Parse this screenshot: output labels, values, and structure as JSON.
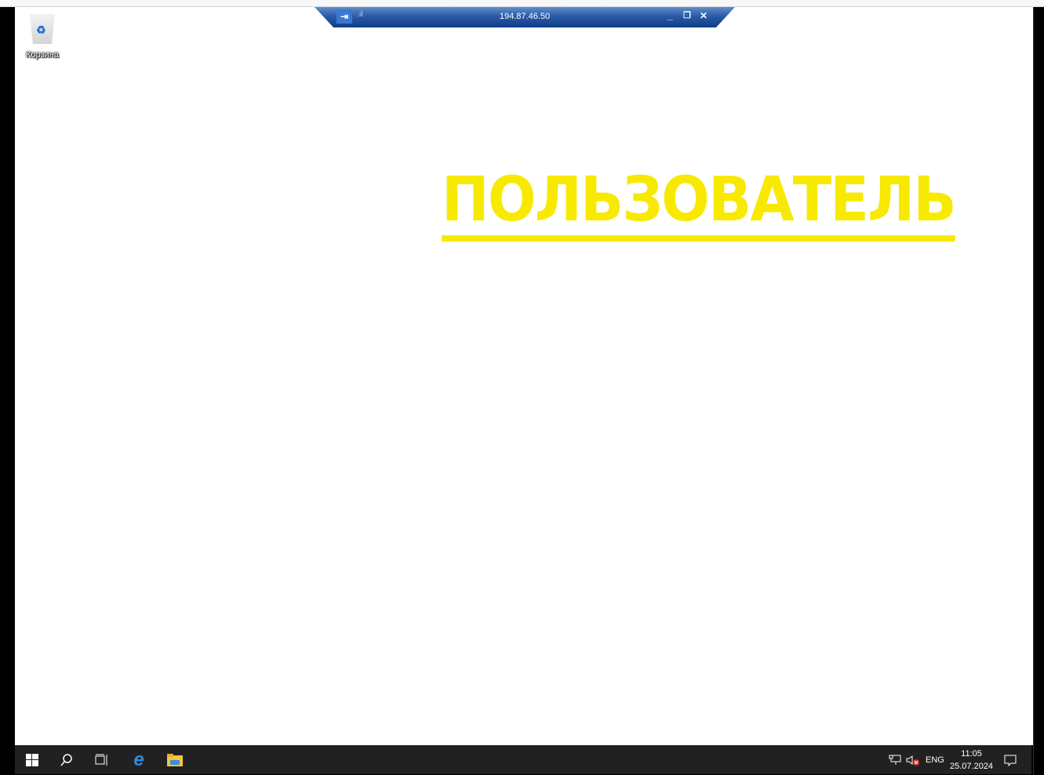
{
  "rdp_bar": {
    "host": "194.87.46.50",
    "pin_icon": "pin-icon",
    "signal_icon": "signal-icon",
    "minimize": "_",
    "restore": "❐",
    "close": "✕"
  },
  "desktop": {
    "icons": [
      {
        "label": "Корзина",
        "icon": "recycle-bin-icon"
      }
    ],
    "wallpaper_text": "ПОЛЬЗОВАТЕЛЬ",
    "wallpaper_color": "#f7ea00"
  },
  "taskbar": {
    "language": "ENG",
    "time": "11:05",
    "date": "25.07.2024"
  }
}
